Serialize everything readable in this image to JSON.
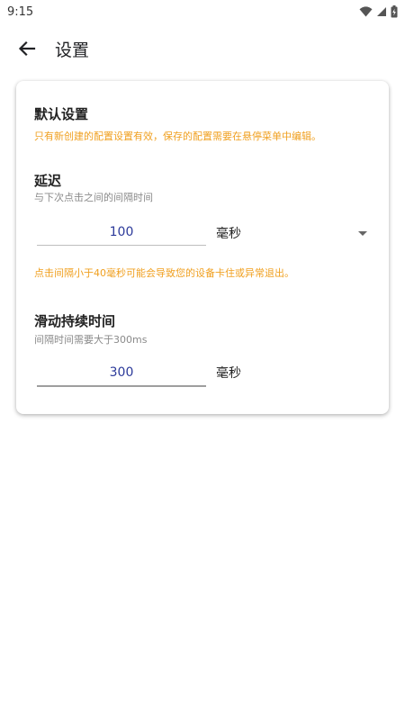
{
  "status_bar": {
    "time": "9:15"
  },
  "app_bar": {
    "title": "设置",
    "back_icon": "arrow-back-icon"
  },
  "default_settings": {
    "title": "默认设置",
    "note": "只有新创建的配置设置有效，保存的配置需要在悬停菜单中编辑。"
  },
  "delay": {
    "title": "延迟",
    "subtitle": "与下次点击之间的间隔时间",
    "value": "100",
    "unit": "毫秒",
    "warning": "点击间隔小于40毫秒可能会导致您的设备卡住或异常退出。"
  },
  "swipe_duration": {
    "title": "滑动持续时间",
    "subtitle": "间隔时间需要大于300ms",
    "value": "300",
    "unit": "毫秒"
  },
  "colors": {
    "accent_orange": "#f0a020",
    "value_blue": "#2c3a9a"
  }
}
